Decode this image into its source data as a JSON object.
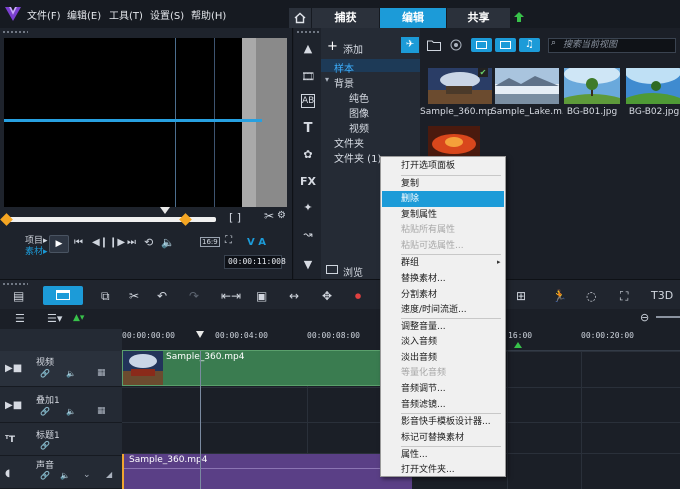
{
  "menubar": {
    "items": [
      "文件(F)",
      "编辑(E)",
      "工具(T)",
      "设置(S)",
      "帮助(H)"
    ]
  },
  "workspace_tabs": {
    "capture": "捕获",
    "edit": "编辑",
    "share": "共享"
  },
  "player": {
    "mode_project": "项目▸",
    "mode_clip": "素材▸",
    "timecode": "00:00:11:008",
    "aspect": "16:9"
  },
  "library": {
    "add_label": "添加",
    "tree": [
      "样本",
      "背景",
      "纯色",
      "图像",
      "视频",
      "文件夹",
      "文件夹 (1)"
    ],
    "browse_label": "浏览",
    "search_placeholder": "搜索当前视图",
    "thumbnails": [
      {
        "label": "Sample_360.mp4",
        "colors": [
          "#2a3d66",
          "#c9d5e6",
          "#6b4b2f"
        ]
      },
      {
        "label": "Sample_Lake.m...",
        "colors": [
          "#a9c4de",
          "#e6eef6",
          "#7a8ea2"
        ]
      },
      {
        "label": "BG-B01.jpg",
        "colors": [
          "#6aa9dc",
          "#cfe6f6",
          "#5e9a3a"
        ]
      },
      {
        "label": "BG-B02.jpg",
        "colors": [
          "#3f8bd0",
          "#bfe0f5",
          "#4f9a35"
        ]
      },
      {
        "label": "",
        "colors": [
          "#4a1a0e",
          "#d9471c",
          "#f5a03a"
        ]
      }
    ]
  },
  "timeline": {
    "ruler": [
      "00:00:00:00",
      "00:00:04:00",
      "00:00:08:00",
      "16:00",
      "00:00:20:00"
    ],
    "tracks": [
      {
        "name": "视频"
      },
      {
        "name": "叠加1"
      },
      {
        "name": "标题1"
      },
      {
        "name": "声音"
      }
    ],
    "video_clip": "Sample_360.mp4",
    "audio_clip": "Sample_360.mp4"
  },
  "context_menu": {
    "items": [
      {
        "label": "打开选项面板",
        "state": "normal"
      },
      {
        "label": "复制",
        "state": "normal"
      },
      {
        "label": "删除",
        "state": "highlight"
      },
      {
        "label": "复制属性",
        "state": "normal"
      },
      {
        "label": "粘贴所有属性",
        "state": "disabled"
      },
      {
        "label": "粘贴可选属性...",
        "state": "disabled"
      },
      {
        "label": "群组",
        "state": "submenu"
      },
      {
        "label": "替换素材...",
        "state": "normal"
      },
      {
        "label": "分割素材",
        "state": "normal"
      },
      {
        "label": "速度/时间流逝...",
        "state": "normal"
      },
      {
        "label": "调整音量...",
        "state": "normal"
      },
      {
        "label": "淡入音频",
        "state": "normal"
      },
      {
        "label": "淡出音频",
        "state": "normal"
      },
      {
        "label": "等量化音频",
        "state": "disabled"
      },
      {
        "label": "音频调节...",
        "state": "normal"
      },
      {
        "label": "音频滤镜...",
        "state": "normal"
      },
      {
        "label": "影音快手模板设计器...",
        "state": "normal"
      },
      {
        "label": "标记可替换素材",
        "state": "normal"
      },
      {
        "label": "属性...",
        "state": "normal"
      },
      {
        "label": "打开文件夹...",
        "state": "normal"
      }
    ]
  },
  "colors": {
    "accent": "#1c9bd8",
    "video_clip": "#3a7c50",
    "audio_clip": "#5a3f86",
    "trim": "#f5a623"
  }
}
